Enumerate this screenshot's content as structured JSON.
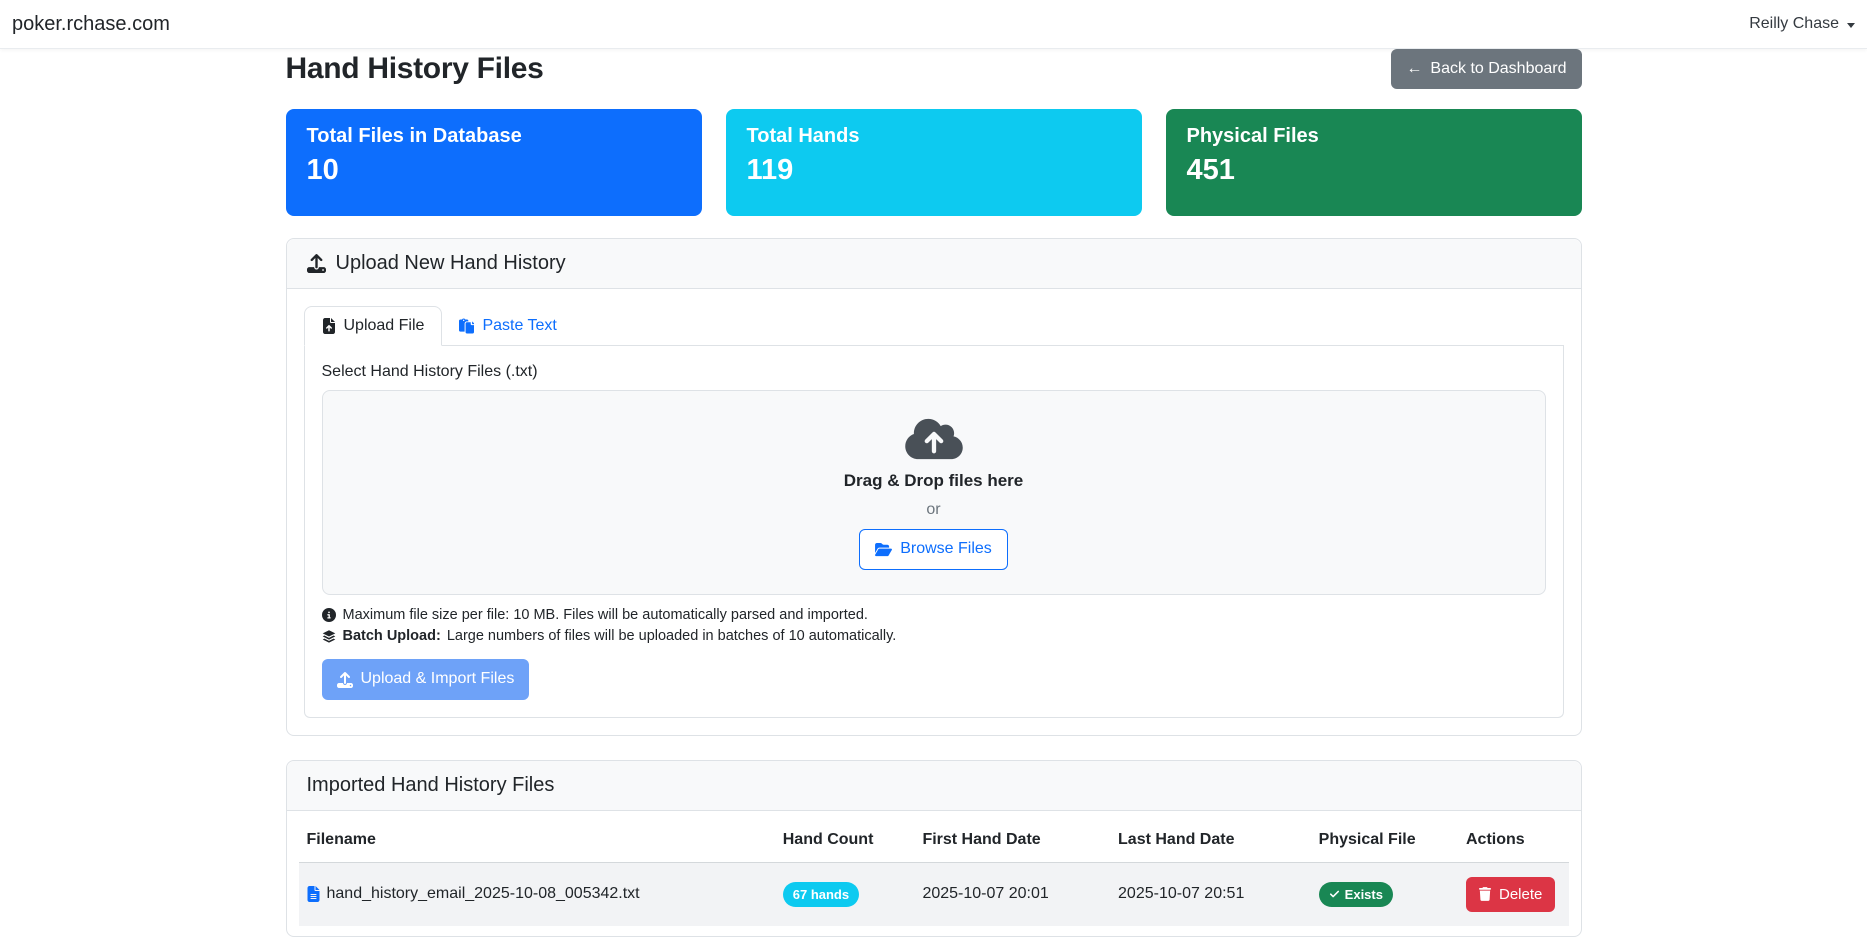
{
  "navbar": {
    "brand": "poker.rchase.com",
    "user": "Reilly Chase"
  },
  "page": {
    "title": "Hand History Files",
    "back_arrow": "←",
    "back_label": "Back to Dashboard"
  },
  "stats": [
    {
      "label": "Total Files in Database",
      "value": "10",
      "color": "#0d6efd"
    },
    {
      "label": "Total Hands",
      "value": "119",
      "color": "#0dcaf0"
    },
    {
      "label": "Physical Files",
      "value": "451",
      "color": "#198754"
    }
  ],
  "upload": {
    "header": "Upload New Hand History",
    "tab_upload": "Upload File",
    "tab_paste": "Paste Text",
    "select_label": "Select Hand History Files (.txt)",
    "drop_title": "Drag & Drop files here",
    "drop_or": "or",
    "browse_label": "Browse Files",
    "note1": "Maximum file size per file: 10 MB. Files will be automatically parsed and imported.",
    "note2_bold": "Batch Upload:",
    "note2_text": "Large numbers of files will be uploaded in batches of 10 automatically.",
    "submit_label": "Upload & Import Files"
  },
  "files": {
    "header": "Imported Hand History Files",
    "columns": [
      "Filename",
      "Hand Count",
      "First Hand Date",
      "Last Hand Date",
      "Physical File",
      "Actions"
    ],
    "rows": [
      {
        "filename": "hand_history_email_2025-10-08_005342.txt",
        "hand_count": "67 hands",
        "first_hand": "2025-10-07 20:01",
        "last_hand": "2025-10-07 20:51",
        "physical": "Exists",
        "action": "Delete"
      }
    ]
  },
  "colors": {
    "primary": "#0d6efd",
    "info": "#0dcaf0",
    "success": "#198754",
    "danger": "#dc3545",
    "secondary": "#6c757d",
    "muted": "#6c757d"
  }
}
